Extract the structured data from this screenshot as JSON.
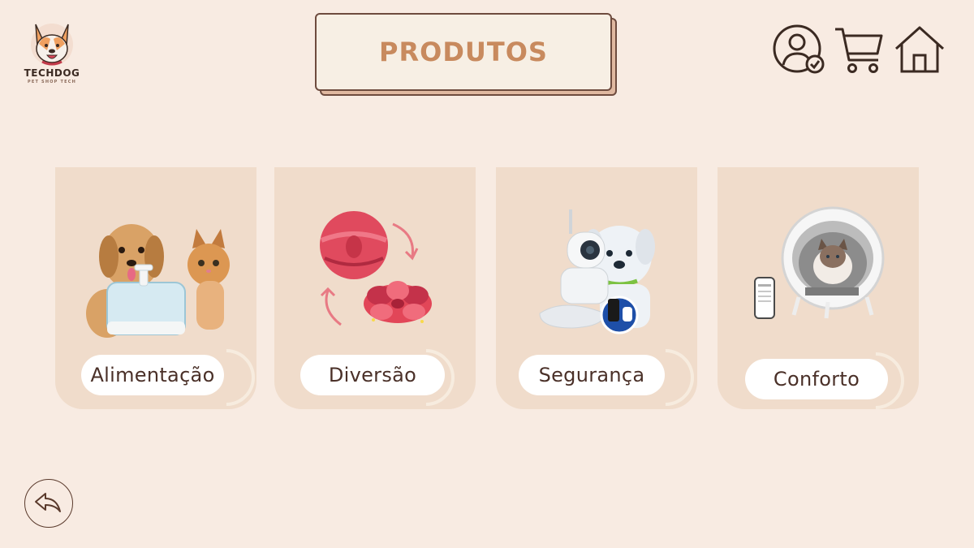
{
  "brand": {
    "name": "TECHDOG",
    "tagline": "PET SHOP TECH",
    "icon": "dog-logo-icon"
  },
  "header": {
    "title": "PRODUTOS"
  },
  "nav": {
    "account_icon": "user-check-icon",
    "cart_icon": "shopping-cart-icon",
    "home_icon": "home-icon",
    "back_icon": "back-arrow-icon"
  },
  "categories": [
    {
      "label": "Alimentação",
      "image": "dog-cat-water-fountain"
    },
    {
      "label": "Diversão",
      "image": "red-toy-ball"
    },
    {
      "label": "Segurança",
      "image": "security-camera-dog"
    },
    {
      "label": "Conforto",
      "image": "smart-litter-box-cat"
    }
  ],
  "colors": {
    "background": "#f8ebe2",
    "card": "#f0dccb",
    "title_text": "#c88a5e",
    "title_shadow": "#e0b8a0",
    "outline": "#5a3a2c"
  }
}
